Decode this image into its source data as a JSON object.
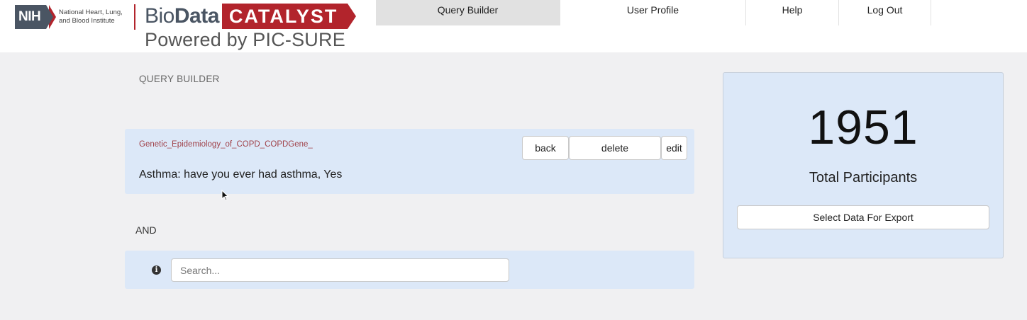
{
  "header": {
    "nih": {
      "mark": "NIH",
      "institute_line1": "National Heart, Lung,",
      "institute_line2": "and Blood Institute"
    },
    "brand": {
      "bio": "Bio",
      "data": "Data",
      "catalyst": "CATALYST",
      "powered_by": "Powered by PIC-SURE"
    },
    "nav": {
      "query_builder": "Query Builder",
      "user_profile": "User Profile",
      "help": "Help",
      "log_out": "Log Out"
    }
  },
  "main": {
    "title": "QUERY BUILDER",
    "filter": {
      "study": "Genetic_Epidemiology_of_COPD_COPDGene_",
      "text": "Asthma: have you ever had asthma, Yes",
      "back_label": "back",
      "delete_label": "delete",
      "edit_label": "edit"
    },
    "operator": "AND",
    "search": {
      "placeholder": "Search...",
      "value": ""
    }
  },
  "summary": {
    "total_count": "1951",
    "total_label": "Total Participants",
    "export_label": "Select Data For Export"
  },
  "colors": {
    "brand_red": "#b2242c",
    "nih_gray": "#4a5563",
    "panel_blue": "#dce8f8",
    "page_bg": "#f0f0f2",
    "study_text": "#a0424a"
  }
}
